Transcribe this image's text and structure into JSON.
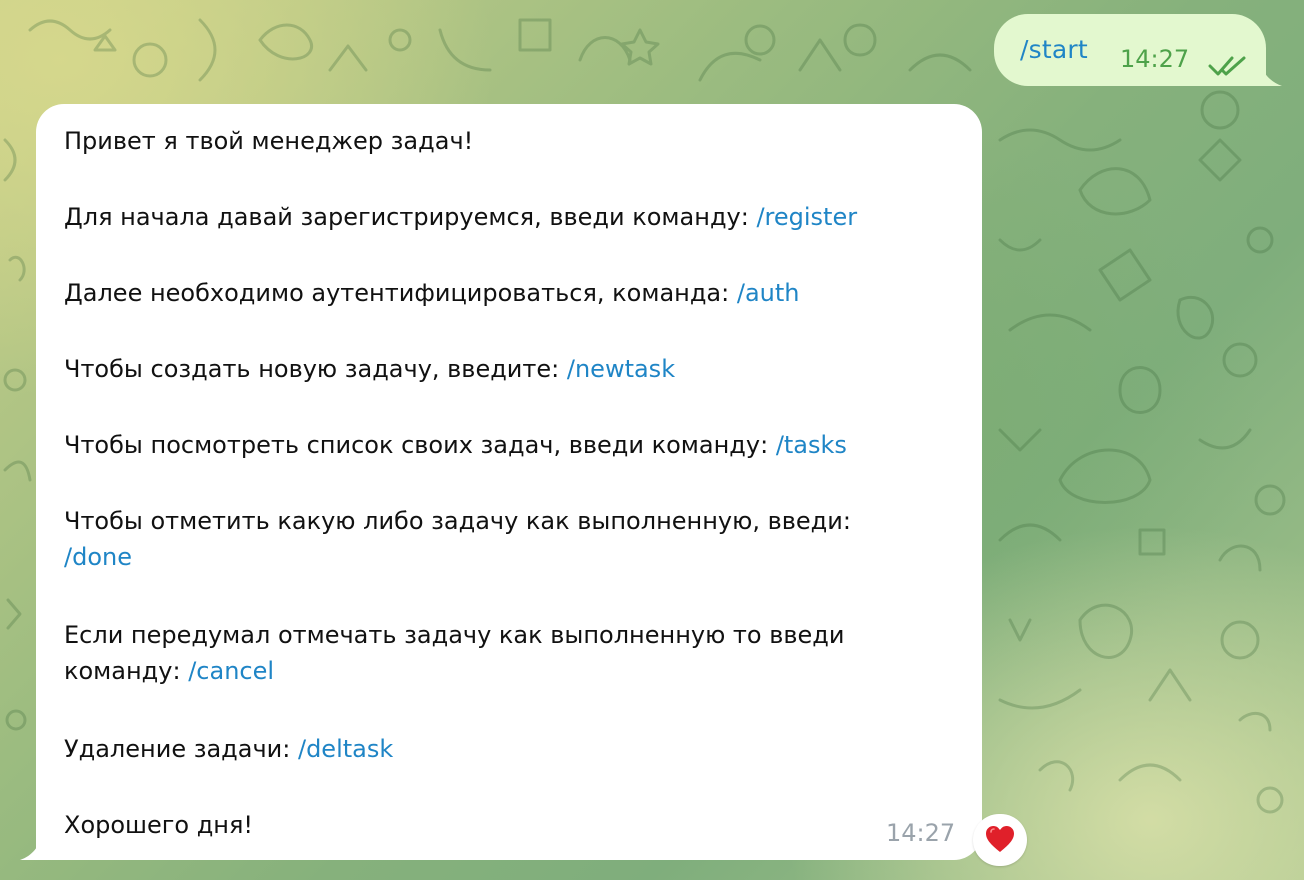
{
  "chat": {
    "outgoing": {
      "text": "/start",
      "time": "14:27",
      "status_icon": "double-check-icon"
    },
    "incoming": {
      "greeting": "Привет я твой менеджер задач!",
      "register_text": "Для начала давай зарегистрируемся, введи команду: ",
      "register_cmd": "/register",
      "auth_text": "Далее необходимо аутентифицироваться, команда: ",
      "auth_cmd": "/auth",
      "newtask_text": "Чтобы создать новую задачу, введите: ",
      "newtask_cmd": "/newtask",
      "tasks_text": "Чтобы посмотреть список своих задач, введи команду: ",
      "tasks_cmd": "/tasks",
      "done_text": "Чтобы отметить какую либо задачу как выполненную, введи:",
      "done_cmd": "/done",
      "cancel_text_line1": "Если передумал отмечать задачу как выполненную то введи",
      "cancel_text_line2": "команду: ",
      "cancel_cmd": "/cancel",
      "deltask_text": "Удаление задачи: ",
      "deltask_cmd": "/deltask",
      "farewell": "Хорошего дня!",
      "time": "14:27"
    },
    "reaction": {
      "icon": "red-heart-icon"
    }
  },
  "colors": {
    "command_link": "#1f85c6",
    "outgoing_bubble": "#e3f8cf",
    "outgoing_time": "#4ea24a",
    "incoming_time": "#9aa3ab",
    "heart": "#e0202a"
  }
}
